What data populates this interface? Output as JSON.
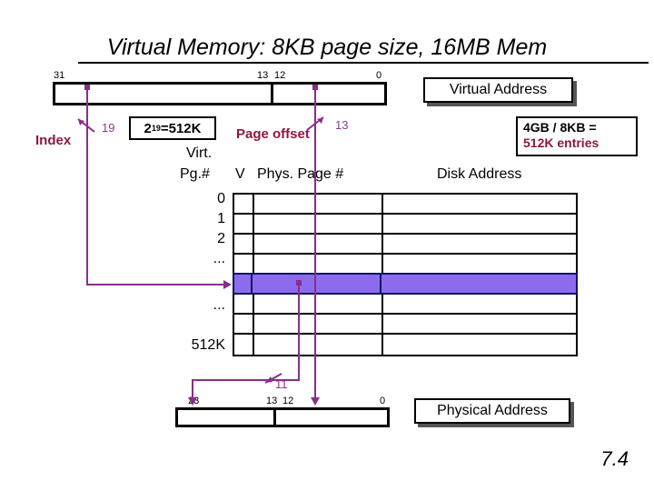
{
  "slide": {
    "title": "Virtual Memory: 8KB page size, 16MB Mem",
    "page_number": "7.4"
  },
  "virtual_address": {
    "label": "Virtual Address",
    "bits": {
      "msb": "31",
      "split_hi": "13",
      "split_lo": "12",
      "lsb": "0"
    },
    "index_label": "Index",
    "index_width": "19",
    "offset_label": "Page offset",
    "offset_width": "13",
    "index_entries_box": "2",
    "index_entries_exp": "19",
    "index_entries_eq": "=512K"
  },
  "entries_note": {
    "line1": "4GB / 8KB =",
    "line2": "512K entries"
  },
  "page_table": {
    "header_line1": "Virt.",
    "header_line2": "Pg.#",
    "columns": [
      "V",
      "Phys. Page #",
      "Disk Address"
    ],
    "row_labels": [
      "0",
      "1",
      "2",
      "...",
      "",
      "...",
      "",
      "512K"
    ],
    "highlighted_row_index": 4
  },
  "physical_address": {
    "label": "Physical Address",
    "bits": {
      "msb": "23",
      "split_hi": "13",
      "split_lo": "12",
      "lsb": "0"
    },
    "ppn_width": "11"
  },
  "colors": {
    "maroon": "#8c1942",
    "purple_line": "#8a2d8a",
    "purple_number": "#8a3a8a",
    "highlight_fill": "#8c6ced",
    "highlight_border": "#101060",
    "black": "#000000"
  }
}
